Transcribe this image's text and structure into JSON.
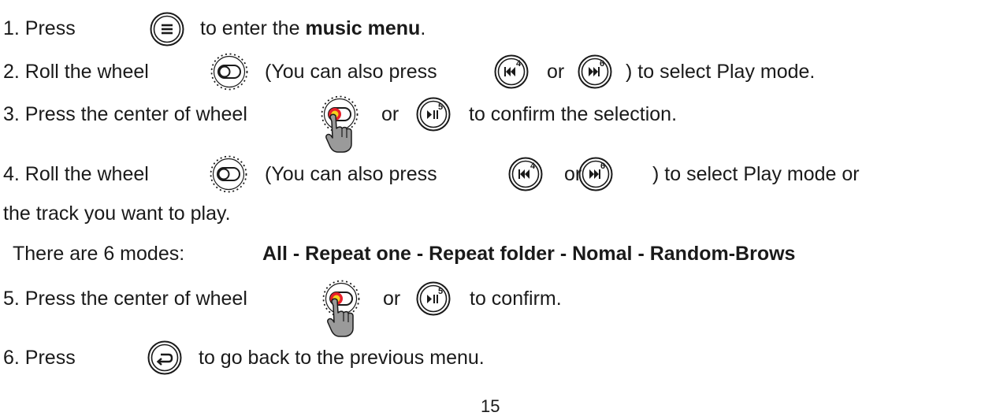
{
  "step1": {
    "before": "1. Press",
    "after_prefix": "to enter the ",
    "after_bold": "music menu",
    "after_suffix": "."
  },
  "step2": {
    "before": "2. Roll the wheel",
    "middle": "(You can also press",
    "or": "or",
    "after": ") to select Play mode."
  },
  "step3": {
    "before": "3. Press the center of wheel",
    "or": "or",
    "after": "to confirm the selection."
  },
  "step4": {
    "before": "4. Roll the wheel",
    "middle": "(You can also press",
    "or": "or",
    "after": ") to select Play mode or",
    "continuation": "the track you want to play."
  },
  "modes": {
    "prefix": "There are 6 modes: ",
    "list": "All - Repeat one - Repeat folder - Nomal - Random-Brows"
  },
  "step5": {
    "before": "5. Press the center of wheel",
    "or": "or",
    "after": "to confirm."
  },
  "step6": {
    "before": "6. Press",
    "after": "to go back to the previous menu."
  },
  "button_numbers": {
    "prev": "4",
    "next": "6",
    "play": "5"
  },
  "page_number": "15",
  "colors": {
    "text": "#1a1a1a",
    "wheel_press_red": "#e8202a",
    "wheel_press_yellow": "#f5d21e",
    "hand_gray": "#9a9a9a"
  },
  "icons": {
    "menu": "menu-button-icon",
    "wheel": "scroll-wheel-icon",
    "wheel_press": "wheel-center-press-icon",
    "prev": "previous-track-button-icon",
    "next": "next-track-button-icon",
    "play": "play-pause-button-icon",
    "back": "back-button-icon"
  }
}
